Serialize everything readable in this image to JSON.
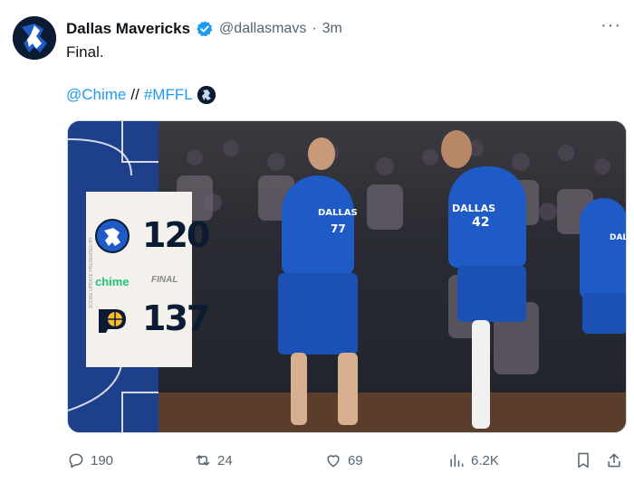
{
  "tweet": {
    "display_name": "Dallas Mavericks",
    "handle": "@dallasmavs",
    "separator": "·",
    "time": "3m",
    "text_line1": "Final.",
    "mention": "@Chime",
    "slashes": "//",
    "hashtag": "#MFFL",
    "more": "···"
  },
  "media": {
    "home_score": "120",
    "away_score": "137",
    "sponsor": "chime",
    "status": "FINAL",
    "side_text": "SCORE UPDATE PRESENTED BY",
    "jersey_left": "DALLAS",
    "jersey_number_left": "77",
    "jersey_right": "DALLAS",
    "jersey_number_right": "42",
    "jersey_far_right": "DALLAS"
  },
  "actions": {
    "replies": "190",
    "reposts": "24",
    "likes": "69",
    "views": "6.2K"
  },
  "colors": {
    "link": "#1d9bf0",
    "text": "#0f1419",
    "muted": "#536471",
    "mavs_blue": "#1e5bc6",
    "chime_green": "#1ec677"
  },
  "icons": {
    "verified": "verified-badge-icon",
    "reply": "reply-icon",
    "repost": "repost-icon",
    "like": "heart-icon",
    "views": "bar-chart-icon",
    "bookmark": "bookmark-icon",
    "share": "share-icon"
  }
}
